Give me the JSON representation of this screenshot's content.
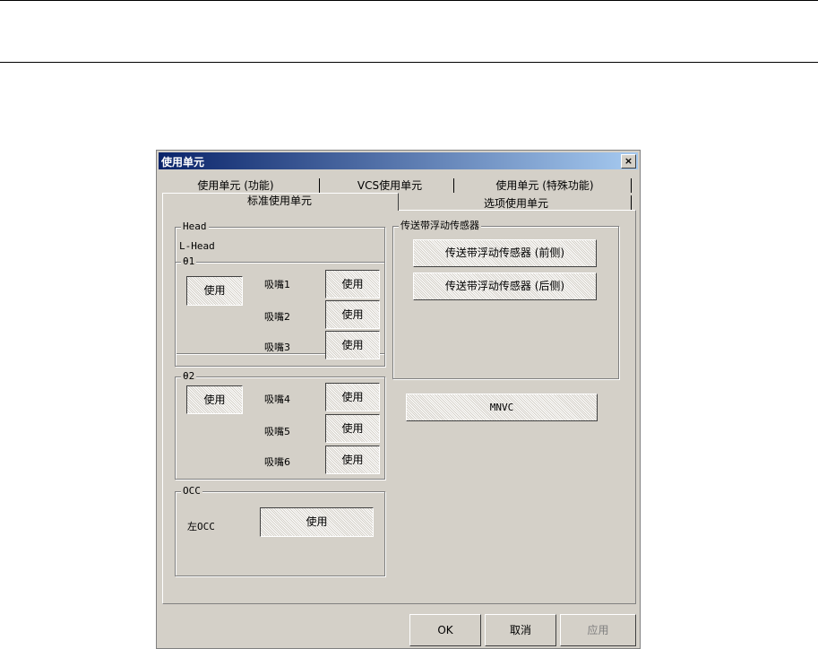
{
  "window": {
    "title": "使用单元",
    "close_glyph": "×"
  },
  "tabs_top": [
    "使用单元 (功能)",
    "VCS使用单元",
    "使用单元 (特殊功能)"
  ],
  "tabs_bottom": [
    "标准使用单元",
    "选项使用单元"
  ],
  "head": {
    "label": "Head",
    "sub": "L-Head",
    "theta1": {
      "label": "θ1",
      "main_button": "使用",
      "nozzles": [
        {
          "label": "吸嘴1",
          "button": "使用"
        },
        {
          "label": "吸嘴2",
          "button": "使用"
        },
        {
          "label": "吸嘴3",
          "button": "使用"
        }
      ]
    },
    "theta2": {
      "label": "θ2",
      "main_button": "使用",
      "nozzles": [
        {
          "label": "吸嘴4",
          "button": "使用"
        },
        {
          "label": "吸嘴5",
          "button": "使用"
        },
        {
          "label": "吸嘴6",
          "button": "使用"
        }
      ]
    }
  },
  "occ": {
    "label": "OCC",
    "item_label": "左OCC",
    "button": "使用"
  },
  "conveyor": {
    "label": "传送带浮动传感器",
    "front": "传送带浮动传感器 (前侧)",
    "rear": "传送带浮动传感器 (后侧)"
  },
  "mnvc": {
    "button": "MNVC"
  },
  "footer": {
    "ok": "OK",
    "cancel": "取消",
    "apply": "应用"
  }
}
